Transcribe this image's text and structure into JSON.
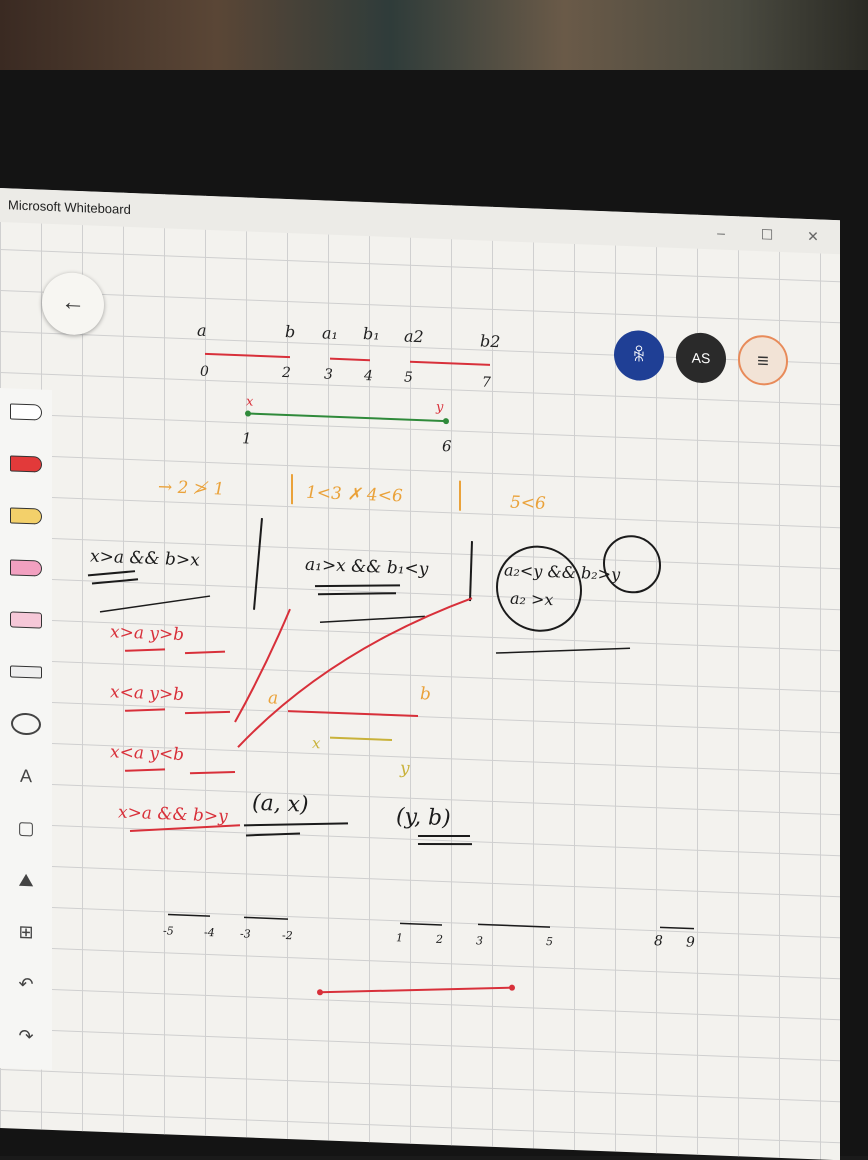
{
  "window": {
    "title": "Microsoft Whiteboard",
    "minimize": "–",
    "maximize": "☐",
    "close": "✕"
  },
  "nav": {
    "back_glyph": "←"
  },
  "header": {
    "user_glyph": "ꆜ",
    "avatar_initials": "AS",
    "menu_glyph": "≡"
  },
  "toolbar": {
    "items": [
      {
        "name": "pen-black-icon"
      },
      {
        "name": "pen-red-icon"
      },
      {
        "name": "pen-yellow-icon"
      },
      {
        "name": "highlighter-pink-icon"
      },
      {
        "name": "eraser-icon"
      },
      {
        "name": "ruler-icon"
      },
      {
        "name": "lasso-icon"
      },
      {
        "name": "text-icon",
        "glyph": "A"
      },
      {
        "name": "note-icon",
        "glyph": "▢"
      },
      {
        "name": "image-icon",
        "glyph": "⛰"
      },
      {
        "name": "insert-icon",
        "glyph": "⊞"
      },
      {
        "name": "undo-icon",
        "glyph": "↶"
      },
      {
        "name": "redo-icon",
        "glyph": "↷"
      }
    ]
  },
  "ink": {
    "top_labels": [
      "a",
      "b",
      "a₁",
      "b₁",
      "a2",
      "b2"
    ],
    "top_numbers": [
      "0",
      "2",
      "3",
      "4",
      "5",
      "7"
    ],
    "xy_labels": [
      "x",
      "y"
    ],
    "xy_numbers": [
      "1",
      "6"
    ],
    "orange_line": [
      "→ 2 ≯ 1",
      "1<3 ✗ 4<6",
      "5<6"
    ],
    "black_cond_1": "x>a && b>x",
    "black_cond_2": "a₁>x && b₁<y",
    "black_cond_3": "a₂<y && b₂>y",
    "black_cond_4": "a₂ >x",
    "red_cases": [
      "x>a   y>b",
      "x<a   y>b",
      "x<a   y<b",
      "x>a && b>y"
    ],
    "seg_labels": [
      "a",
      "b",
      "x",
      "y"
    ],
    "intervals": [
      "(a, x)",
      "(y, b)"
    ],
    "bottom_numbers": [
      "-5",
      "-4",
      "-3",
      "-2",
      "1",
      "2",
      "3",
      "5",
      "8",
      "9"
    ]
  },
  "colors": {
    "red_ink": "#d8303a",
    "black_ink": "#1b1b1b",
    "green_ink": "#2f8a3a",
    "orange_ink": "#eaa23a",
    "yellow_ink": "#c9b23a",
    "user_button": "#1f3f95"
  }
}
